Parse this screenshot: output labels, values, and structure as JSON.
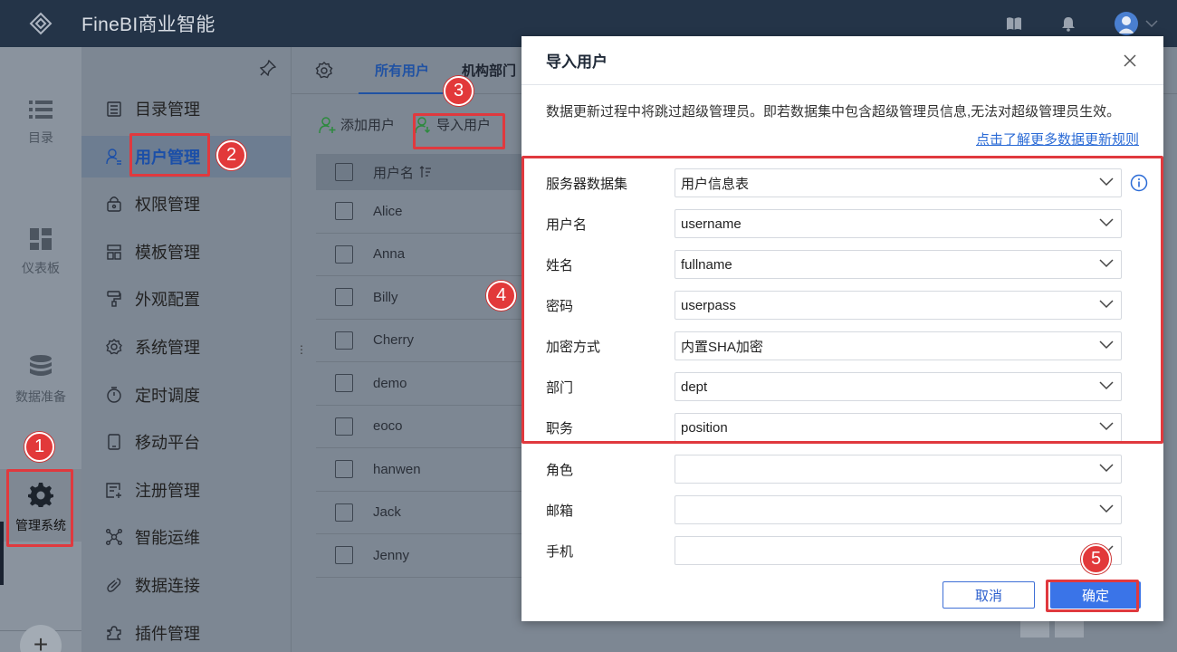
{
  "app": {
    "title": "FineBI商业智能"
  },
  "rail": {
    "items": [
      {
        "label": "目录",
        "icon": "list-icon"
      },
      {
        "label": "仪表板",
        "icon": "dashboard-icon"
      },
      {
        "label": "数据准备",
        "icon": "database-icon"
      },
      {
        "label": "管理系统",
        "icon": "gear-icon"
      }
    ],
    "plus_label": "+"
  },
  "nav": {
    "items": [
      {
        "label": "目录管理",
        "icon": "catalog-icon"
      },
      {
        "label": "用户管理",
        "icon": "user-manage-icon"
      },
      {
        "label": "权限管理",
        "icon": "lock-icon"
      },
      {
        "label": "模板管理",
        "icon": "template-icon"
      },
      {
        "label": "外观配置",
        "icon": "paint-icon"
      },
      {
        "label": "系统管理",
        "icon": "gear-icon"
      },
      {
        "label": "定时调度",
        "icon": "timer-icon"
      },
      {
        "label": "移动平台",
        "icon": "mobile-icon"
      },
      {
        "label": "注册管理",
        "icon": "register-icon"
      },
      {
        "label": "智能运维",
        "icon": "ops-icon"
      },
      {
        "label": "数据连接",
        "icon": "link-icon"
      },
      {
        "label": "插件管理",
        "icon": "plugin-icon"
      }
    ]
  },
  "tabs": [
    "所有用户",
    "机构部门"
  ],
  "toolbar": {
    "add_user": "添加用户",
    "import_user": "导入用户"
  },
  "user_table": {
    "header": "用户名",
    "rows": [
      "Alice",
      "Anna",
      "Billy",
      "Cherry",
      "demo",
      "eoco",
      "hanwen",
      "Jack",
      "Jenny"
    ]
  },
  "callouts": [
    "1",
    "2",
    "3",
    "4",
    "5"
  ],
  "dialog": {
    "title": "导入用户",
    "notice": "数据更新过程中将跳过超级管理员。即若数据集中包含超级管理员信息,无法对超级管理员生效。",
    "link": "点击了解更多数据更新规则",
    "fields": [
      {
        "label": "服务器数据集",
        "value": "用户信息表"
      },
      {
        "label": "用户名",
        "value": "username"
      },
      {
        "label": "姓名",
        "value": "fullname"
      },
      {
        "label": "密码",
        "value": "userpass"
      },
      {
        "label": "加密方式",
        "value": "内置SHA加密"
      },
      {
        "label": "部门",
        "value": "dept"
      },
      {
        "label": "职务",
        "value": "position"
      },
      {
        "label": "角色",
        "value": ""
      },
      {
        "label": "邮箱",
        "value": ""
      },
      {
        "label": "手机",
        "value": ""
      }
    ],
    "cancel": "取消",
    "confirm": "确定"
  },
  "colors": {
    "accent": "#3a74e8",
    "callout": "#e2393a",
    "topbar": "#243448"
  }
}
